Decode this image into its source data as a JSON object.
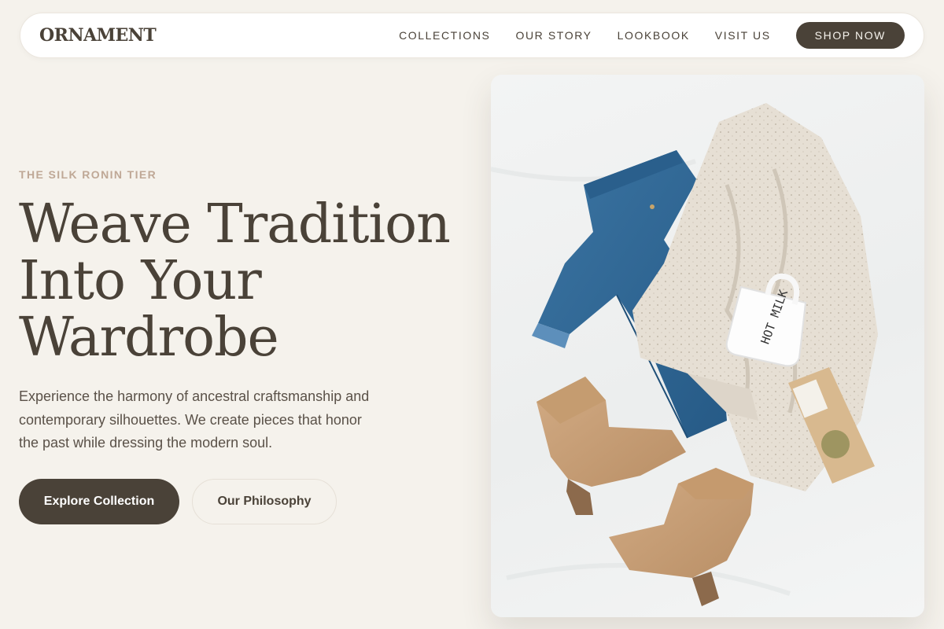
{
  "brand": {
    "logo": "ORNAMENT"
  },
  "nav": {
    "links": [
      "COLLECTIONS",
      "OUR STORY",
      "LOOKBOOK",
      "VISIT US"
    ],
    "cta": "SHOP NOW"
  },
  "hero": {
    "eyebrow": "THE SILK RONIN TIER",
    "headline": [
      "Weave Tradition",
      "Into Your",
      "Wardrobe"
    ],
    "description": "Experience the harmony of ancestral craftsmanship and contemporary silhouettes. We create pieces that honor the past while dressing the modern soul.",
    "primary_button": "Explore Collection",
    "secondary_button": "Our Philosophy",
    "image_mug_text": "HOT MILK"
  },
  "colors": {
    "background": "#f5f2ec",
    "primary": "#4a4238",
    "accent": "#bfa896",
    "denim": "#2f6592",
    "suede": "#c49c74",
    "knit": "#e7e0d6"
  }
}
